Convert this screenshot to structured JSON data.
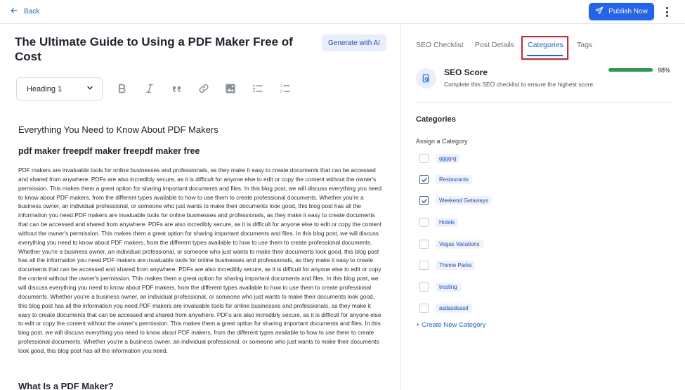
{
  "header": {
    "back_label": "Back",
    "publish_label": "Publish Now"
  },
  "editor": {
    "title": "The Ultimate Guide to Using a PDF Maker Free of Cost",
    "generate_ai_label": "Generate with AI",
    "heading_select_value": "Heading 1",
    "toolbar_icons": [
      "bold-icon",
      "italic-icon",
      "quote-icon",
      "link-icon",
      "image-icon",
      "bullet-list-icon",
      "numbered-list-icon"
    ],
    "heading_everything": "Everything You Need to Know About PDF Makers",
    "heading_pdfmaker": "pdf maker freepdf maker freepdf maker free",
    "paragraph": "PDF makers are invaluable tools for online businesses and professionals, as they make it easy to create documents that can be accessed and shared from anywhere. PDFs are also incredibly secure, as it is difficult for anyone else to edit or copy the content without the owner's permission. This makes them a great option for sharing important documents and files. In this blog post, we will discuss everything you need to know about PDF makers, from the different types available to how to use them to create professional documents. Whether you're a business owner, an individual professional, or someone who just wants to make their documents look good, this blog post has all the information you need.PDF makers are invaluable tools for online businesses and professionals, as they make it easy to create documents that can be accessed and shared from anywhere. PDFs are also incredibly secure, as it is difficult for anyone else to edit or copy the content without the owner's permission. This makes them a great option for sharing important documents and files. In this blog post, we will discuss everything you need to know about PDF makers, from the different types available to how to use them to create professional documents. Whether you're a business owner, an individual professional, or someone who just wants to make their documents look good, this blog post has all the information you need.PDF makers are invaluable tools for online businesses and professionals, as they make it easy to create documents that can be accessed and shared from anywhere. PDFs are also incredibly secure, as it is difficult for anyone else to edit or copy the content without the owner's permission. This makes them a great option for sharing important documents and files. In this blog post, we will discuss everything you need to know about PDF makers, from the different types available to how to use them to create professional documents. Whether you're a business owner, an individual professional, or someone who just wants to make their documents look good, this blog post has all the information you need.PDF makers are invaluable tools for online businesses and professionals, as they make it easy to create documents that can be accessed and shared from anywhere. PDFs are also incredibly secure, as it is difficult for anyone else to edit or copy the content without the owner's permission. This makes them a great option for sharing important documents and files. In this blog post, we will discuss everything you need to know about PDF makers, from the different types available to how to use them to create professional documents. Whether you're a business owner, an individual professional, or someone who just wants to make their documents look good, this blog post has all the information you need.",
    "heading_what": "What Is a PDF Maker?"
  },
  "panel": {
    "tabs": [
      "SEO Checklist",
      "Post Details",
      "Categories",
      "Tags"
    ],
    "active_tab": "Categories",
    "seo": {
      "title": "SEO Score",
      "subtitle": "Complete this SEO checklist to ensure the highest score.",
      "score_label": "98%",
      "score": 98
    },
    "categories_heading": "Categories",
    "assign_label": "Assign a Category",
    "categories": [
      {
        "label": "ggggrg",
        "checked": false
      },
      {
        "label": "Restaurants",
        "checked": true
      },
      {
        "label": "Weekend Getaways",
        "checked": true
      },
      {
        "label": "Hotels",
        "checked": false
      },
      {
        "label": "Vegas Vacations",
        "checked": false
      },
      {
        "label": "Theme Parks",
        "checked": false
      },
      {
        "label": "tresting",
        "checked": false
      },
      {
        "label": "asdasdsasd",
        "checked": false
      }
    ],
    "create_label": "+ Create New Category"
  },
  "colors": {
    "accent": "#2563eb",
    "progress": "#16a34a",
    "highlight": "#e11d2f"
  }
}
